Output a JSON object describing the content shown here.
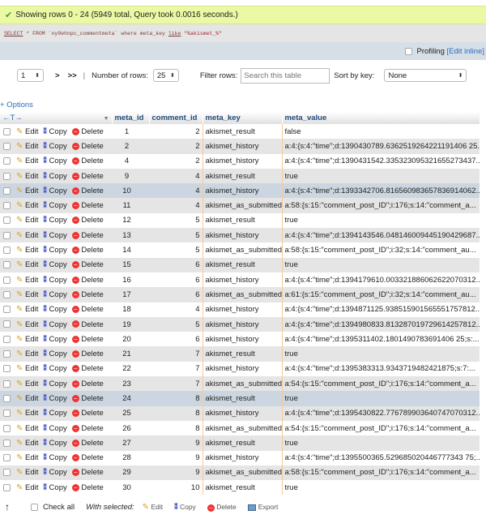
{
  "status": {
    "message": "Showing rows 0 - 24 (5949 total, Query took 0.0016 seconds.)",
    "icon": "check-icon",
    "color": "#ebf8a4"
  },
  "sql": {
    "select": "SELECT",
    "middle1": " * FROM `ny0ehnpc_commentmeta` where meta_key ",
    "like": "like",
    "value": " \"%akismet_%\""
  },
  "profiling": {
    "label": "Profiling",
    "edit_inline": "[Edit inline]"
  },
  "nav": {
    "page_value": "1",
    "next": ">",
    "last": ">>",
    "separator": "|",
    "rows_label": "Number of rows:",
    "rows_value": "25",
    "filter_label": "Filter rows:",
    "filter_placeholder": "Search this table",
    "sort_label": "Sort by key:",
    "sort_value": "None"
  },
  "options_label": "+ Options",
  "table": {
    "resize_glyph": "←T→",
    "sort_glyph": "▼",
    "columns": [
      "meta_id",
      "comment_id",
      "meta_key",
      "meta_value"
    ],
    "action_labels": {
      "edit": "Edit",
      "copy": "Copy",
      "delete": "Delete"
    },
    "rows": [
      {
        "meta_id": "1",
        "comment_id": "2",
        "meta_key": "akismet_result",
        "meta_value": "false"
      },
      {
        "meta_id": "2",
        "comment_id": "2",
        "meta_key": "akismet_history",
        "meta_value": "a:4:{s:4:\"time\";d:1390430789.6362519264221191406 25..."
      },
      {
        "meta_id": "4",
        "comment_id": "2",
        "meta_key": "akismet_history",
        "meta_value": "a:4:{s:4:\"time\";d:1390431542.335323095321655273437..."
      },
      {
        "meta_id": "9",
        "comment_id": "4",
        "meta_key": "akismet_result",
        "meta_value": "true"
      },
      {
        "meta_id": "10",
        "comment_id": "4",
        "meta_key": "akismet_history",
        "meta_value": "a:4:{s:4:\"time\";d:1393342706.816560983657836914062..."
      },
      {
        "meta_id": "11",
        "comment_id": "4",
        "meta_key": "akismet_as_submitted",
        "meta_value": "a:58:{s:15:\"comment_post_ID\";i:176;s:14:\"comment_a..."
      },
      {
        "meta_id": "12",
        "comment_id": "5",
        "meta_key": "akismet_result",
        "meta_value": "true"
      },
      {
        "meta_id": "13",
        "comment_id": "5",
        "meta_key": "akismet_history",
        "meta_value": "a:4:{s:4:\"time\";d:1394143546.048146009445190429687..."
      },
      {
        "meta_id": "14",
        "comment_id": "5",
        "meta_key": "akismet_as_submitted",
        "meta_value": "a:58:{s:15:\"comment_post_ID\";i:32;s:14:\"comment_au..."
      },
      {
        "meta_id": "15",
        "comment_id": "6",
        "meta_key": "akismet_result",
        "meta_value": "true"
      },
      {
        "meta_id": "16",
        "comment_id": "6",
        "meta_key": "akismet_history",
        "meta_value": "a:4:{s:4:\"time\";d:1394179610.003321886062622070312..."
      },
      {
        "meta_id": "17",
        "comment_id": "6",
        "meta_key": "akismet_as_submitted",
        "meta_value": "a:61:{s:15:\"comment_post_ID\";i:32;s:14:\"comment_au..."
      },
      {
        "meta_id": "18",
        "comment_id": "4",
        "meta_key": "akismet_history",
        "meta_value": "a:4:{s:4:\"time\";d:1394871125.938515901565551757812..."
      },
      {
        "meta_id": "19",
        "comment_id": "5",
        "meta_key": "akismet_history",
        "meta_value": "a:4:{s:4:\"time\";d:1394980833.813287019729614257812..."
      },
      {
        "meta_id": "20",
        "comment_id": "6",
        "meta_key": "akismet_history",
        "meta_value": "a:4:{s:4:\"time\";d:1395311402.1801490783691406 25;s:..."
      },
      {
        "meta_id": "21",
        "comment_id": "7",
        "meta_key": "akismet_result",
        "meta_value": "true"
      },
      {
        "meta_id": "22",
        "comment_id": "7",
        "meta_key": "akismet_history",
        "meta_value": "a:4:{s:4:\"time\";d:1395383313.9343719482421875;s:7:..."
      },
      {
        "meta_id": "23",
        "comment_id": "7",
        "meta_key": "akismet_as_submitted",
        "meta_value": "a:54:{s:15:\"comment_post_ID\";i:176;s:14:\"comment_a..."
      },
      {
        "meta_id": "24",
        "comment_id": "8",
        "meta_key": "akismet_result",
        "meta_value": "true"
      },
      {
        "meta_id": "25",
        "comment_id": "8",
        "meta_key": "akismet_history",
        "meta_value": "a:4:{s:4:\"time\";d:1395430822.776789903640747070312..."
      },
      {
        "meta_id": "26",
        "comment_id": "8",
        "meta_key": "akismet_as_submitted",
        "meta_value": "a:54:{s:15:\"comment_post_ID\";i:176;s:14:\"comment_a..."
      },
      {
        "meta_id": "27",
        "comment_id": "9",
        "meta_key": "akismet_result",
        "meta_value": "true"
      },
      {
        "meta_id": "28",
        "comment_id": "9",
        "meta_key": "akismet_history",
        "meta_value": "a:4:{s:4:\"time\";d:1395500365.529685020446777343 75;..."
      },
      {
        "meta_id": "29",
        "comment_id": "9",
        "meta_key": "akismet_as_submitted",
        "meta_value": "a:58:{s:15:\"comment_post_ID\";i:176;s:14:\"comment_a..."
      },
      {
        "meta_id": "30",
        "comment_id": "10",
        "meta_key": "akismet_result",
        "meta_value": "true"
      }
    ],
    "highlighted_rows": [
      4,
      18
    ]
  },
  "footer": {
    "up_arrow": "↑",
    "check_all": "Check all",
    "with_selected": "With selected:",
    "edit": "Edit",
    "copy": "Copy",
    "delete": "Delete",
    "export": "Export"
  }
}
